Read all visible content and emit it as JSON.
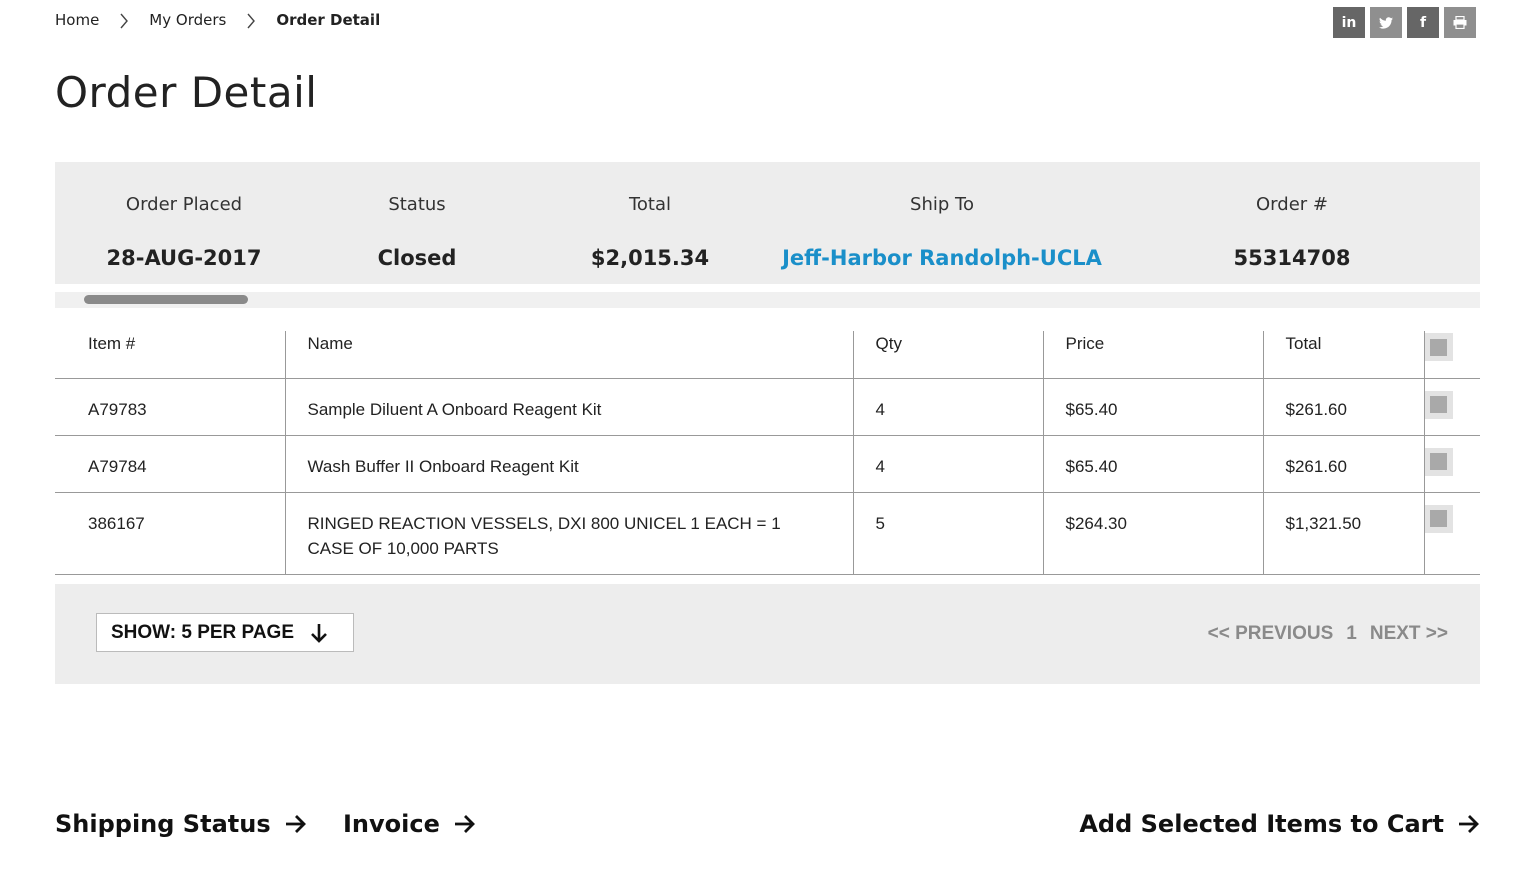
{
  "breadcrumb": {
    "items": [
      "Home",
      "My Orders",
      "Order Detail"
    ]
  },
  "share": {
    "icons": [
      "linkedin-icon",
      "twitter-icon",
      "facebook-icon",
      "print-icon"
    ],
    "linkedin_label": "in",
    "facebook_label": "f"
  },
  "page_title": "Order Detail",
  "summary": {
    "order_placed_label": "Order Placed",
    "order_placed": "28-AUG-2017",
    "status_label": "Status",
    "status": "Closed",
    "total_label": "Total",
    "total": "$2,015.34",
    "ship_to_label": "Ship To",
    "ship_to": "Jeff-Harbor Randolph-UCLA",
    "order_no_label": "Order #",
    "order_no": "55314708",
    "link_color": "#1a8fc9"
  },
  "table": {
    "headers": [
      "Item #",
      "Name",
      "Qty",
      "Price",
      "Total"
    ],
    "rows": [
      {
        "item": "A79783",
        "name": "Sample Diluent A Onboard Reagent Kit",
        "qty": "4",
        "price": "$65.40",
        "total": "$261.60"
      },
      {
        "item": "A79784",
        "name": "Wash Buffer II Onboard Reagent Kit",
        "qty": "4",
        "price": "$65.40",
        "total": "$261.60"
      },
      {
        "item": "386167",
        "name": "RINGED REACTION VESSELS, DXI 800 UNICEL 1 EACH = 1 CASE OF 10,000 PARTS",
        "qty": "5",
        "price": "$264.30",
        "total": "$1,321.50"
      }
    ]
  },
  "pagination": {
    "per_page_label": "SHOW: 5 PER PAGE",
    "previous": "<< PREVIOUS",
    "page": "1",
    "next": "NEXT >>"
  },
  "actions": {
    "shipping_status": "Shipping Status",
    "invoice": "Invoice",
    "add_to_cart": "Add Selected Items to Cart"
  }
}
